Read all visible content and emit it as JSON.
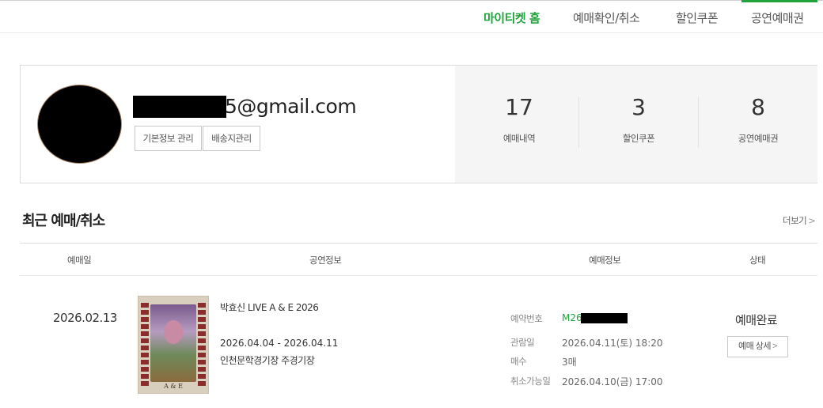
{
  "nav": {
    "tabs": [
      {
        "label": "마이티켓 홈",
        "active": true
      },
      {
        "label": "예매확인/취소",
        "active": false
      },
      {
        "label": "할인쿠폰",
        "active": false
      },
      {
        "label": "공연예매권",
        "active": false
      }
    ]
  },
  "profile": {
    "email_visible": "5@gmail.com",
    "buttons": {
      "basic_info": "기본정보 관리",
      "shipping": "배송지관리"
    },
    "stats": [
      {
        "value": "17",
        "label": "예매내역"
      },
      {
        "value": "3",
        "label": "할인쿠폰"
      },
      {
        "value": "8",
        "label": "공연예매권"
      }
    ]
  },
  "recent": {
    "title": "최근 예매/취소",
    "more": "더보기",
    "more_chevron": ">",
    "columns": [
      "예매일",
      "공연정보",
      "예매정보",
      "상태"
    ],
    "booking": {
      "date": "2026.02.13",
      "poster_text": "A & E",
      "show_title": "박효신 LIVE A & E 2026",
      "period": "2026.04.04 - 2026.04.11",
      "venue": "인천문학경기장 주경기장",
      "info": [
        {
          "label": "예약번호",
          "value": "M26"
        },
        {
          "label": "관람일",
          "value": "2026.04.11(토) 18:20"
        },
        {
          "label": "매수",
          "value": "3매"
        },
        {
          "label": "취소가능일",
          "value": "2026.04.10(금) 17:00"
        }
      ],
      "status": "예매완료",
      "detail_button": "예매 상세",
      "detail_chevron": ">"
    }
  },
  "colors": {
    "accent_green": "#1fa33a",
    "stats_bg": "#f5f5f5"
  }
}
